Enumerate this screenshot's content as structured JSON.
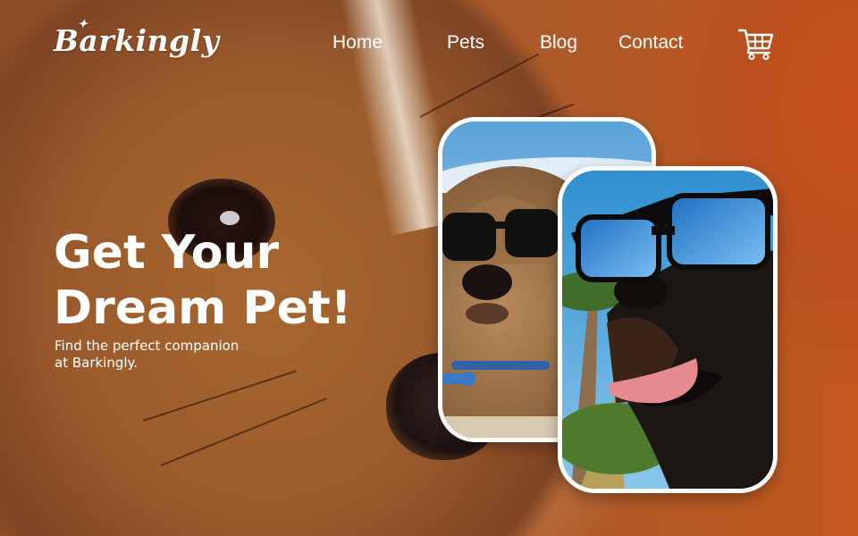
{
  "brand": {
    "name": "Barkingly",
    "mark_icon": "paw-leaf-icon"
  },
  "nav": {
    "items": [
      {
        "label": "Home"
      },
      {
        "label": "Pets"
      },
      {
        "label": "Blog"
      },
      {
        "label": "Contact"
      }
    ],
    "cart_icon": "shopping-cart-icon"
  },
  "hero": {
    "title_line1": "Get Your",
    "title_line2": "Dream Pet!",
    "subtitle_line1": "Find the perfect companion",
    "subtitle_line2": "at Barkingly."
  },
  "photos": [
    {
      "subject": "dog-wearing-sunglasses-photo"
    },
    {
      "subject": "dog-wearing-blue-mirrored-sunglasses-photo"
    }
  ],
  "colors": {
    "accent_orange": "#c2581e",
    "fur_brown": "#9a5a2b",
    "text": "#ffffff"
  }
}
